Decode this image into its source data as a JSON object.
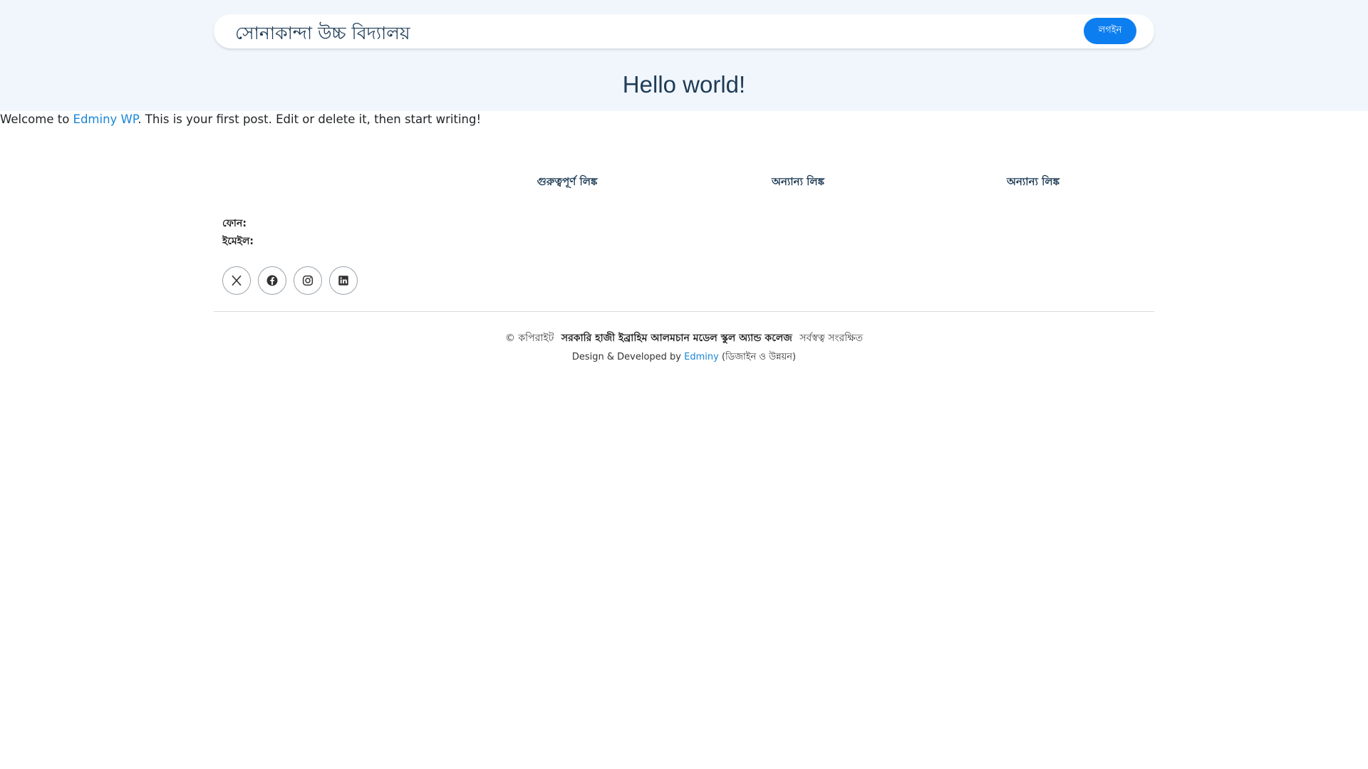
{
  "header": {
    "site_title": "সোনাকান্দা উচ্চ বিদ্যালয়",
    "login_label": "লগইন"
  },
  "post": {
    "title": "Hello world!",
    "text_before": "Welcome to ",
    "link_text": "Edminy WP",
    "text_after": ". This is your first post. Edit or delete it, then start writing!"
  },
  "footer": {
    "headings": [
      "গুরুত্বপূর্ণ লিঙ্ক",
      "অন্যান্য লিঙ্ক",
      "অন্যান্য লিঙ্ক"
    ],
    "phone_label": "ফোন:",
    "email_label": "ইমেইল:",
    "socials": [
      "x-icon",
      "facebook-icon",
      "instagram-icon",
      "linkedin-icon"
    ],
    "copyright_prefix": "© কপিরাইট",
    "organization": "সরকারি হাজী ইব্রাহিম আলমচান মডেল স্কুল অ্যান্ড কলেজ",
    "rights": "সর্বস্বত্ব সংরক্ষিত",
    "credit_prefix": "Design & Developed by",
    "credit_link": "Edminy",
    "credit_suffix": "(ডিজাইন ও উন্নয়ন)"
  },
  "colors": {
    "band_background": "#f1f6fc",
    "accent": "#0d7ef0",
    "link": "#1a86d6",
    "title": "#1f3c56"
  }
}
